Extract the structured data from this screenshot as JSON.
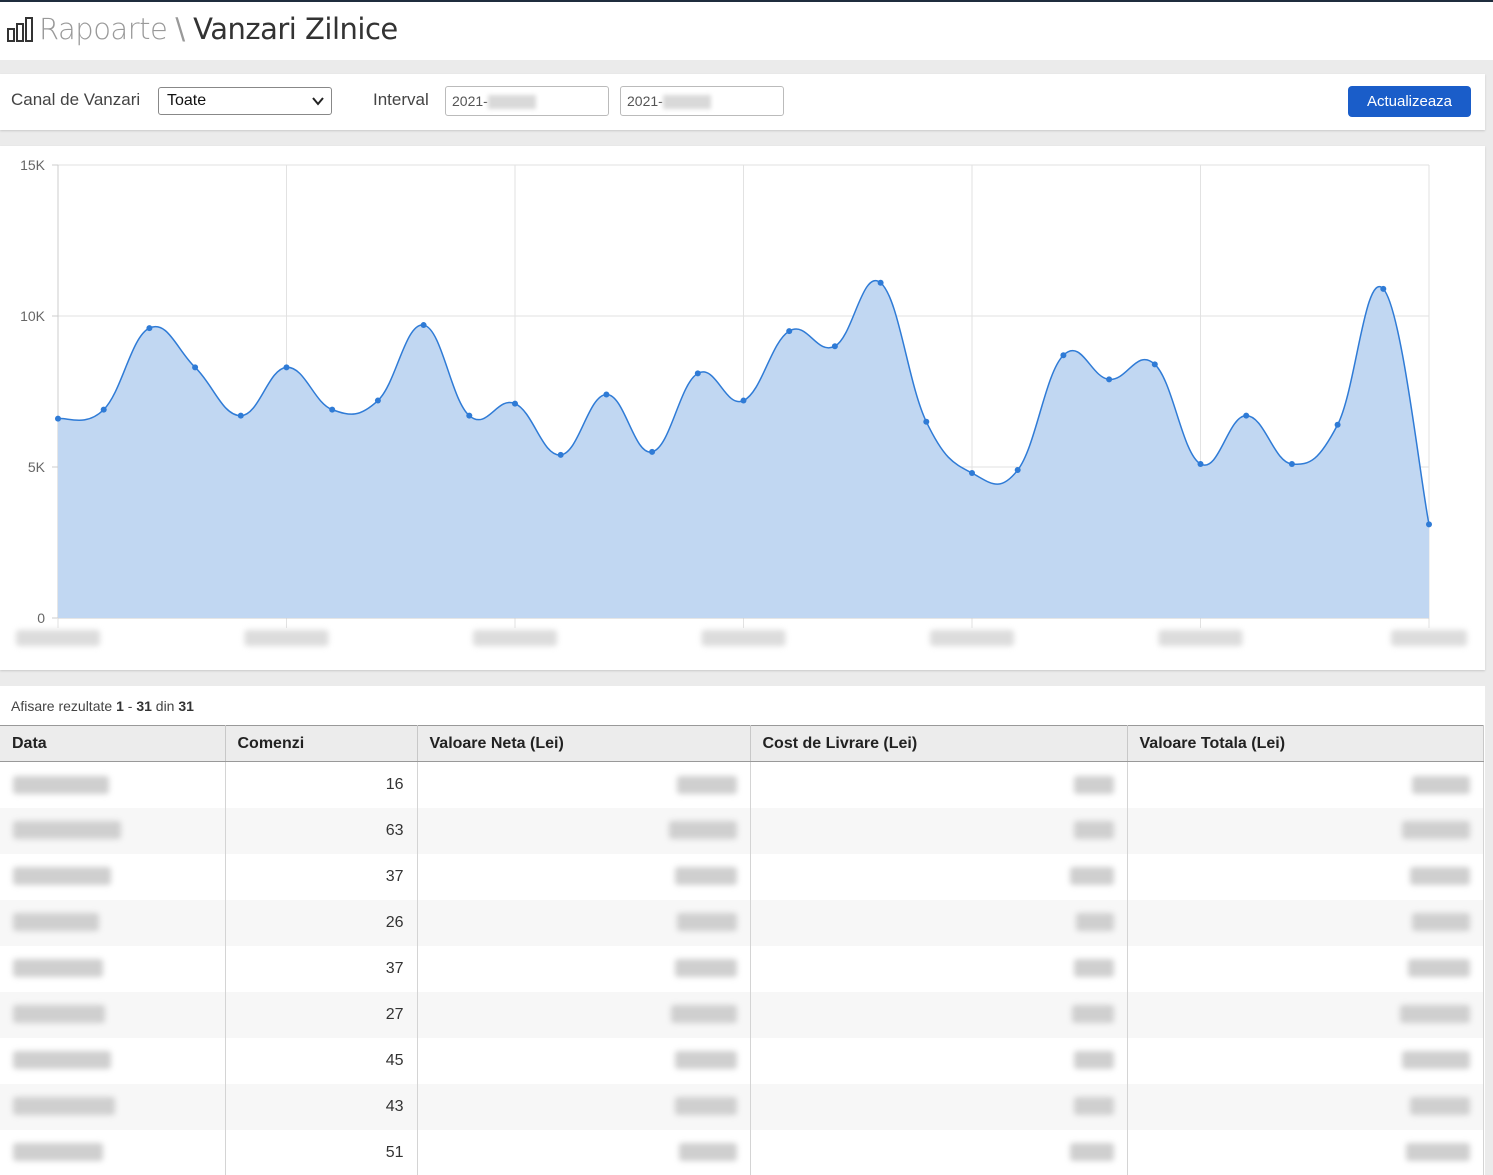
{
  "header": {
    "breadcrumb": "Rapoarte",
    "separator": "\\",
    "title": "Vanzari Zilnice"
  },
  "filters": {
    "channel_label": "Canal de Vanzari",
    "channel_value": "Toate",
    "interval_label": "Interval",
    "date_from": "2021-",
    "date_to": "2021-",
    "submit_label": "Actualizeaza"
  },
  "chart_data": {
    "type": "area",
    "y_ticks": [
      "15K",
      "10K",
      "5K",
      "0"
    ],
    "ylim": [
      0,
      15000
    ],
    "grid": true,
    "color": "#2f7bd6",
    "fill": "#c1d7f2",
    "values": [
      6600,
      6900,
      9600,
      8300,
      6700,
      8300,
      6900,
      7200,
      9700,
      6700,
      7100,
      5400,
      7400,
      5500,
      8100,
      7200,
      9500,
      9000,
      11100,
      6500,
      4800,
      4900,
      8700,
      7900,
      8400,
      5100,
      6700,
      5100,
      6400,
      10900,
      3100
    ]
  },
  "table": {
    "summary_prefix": "Afisare rezultate",
    "range_start": "1",
    "range_sep": "-",
    "range_end": "31",
    "of_word": "din",
    "total": "31",
    "columns": [
      "Data",
      "Comenzi",
      "Valoare Neta (Lei)",
      "Cost de Livrare (Lei)",
      "Valoare Totala (Lei)"
    ],
    "rows": [
      {
        "comenzi": "16"
      },
      {
        "comenzi": "63"
      },
      {
        "comenzi": "37"
      },
      {
        "comenzi": "26"
      },
      {
        "comenzi": "37"
      },
      {
        "comenzi": "27"
      },
      {
        "comenzi": "45"
      },
      {
        "comenzi": "43"
      },
      {
        "comenzi": "51"
      }
    ]
  }
}
